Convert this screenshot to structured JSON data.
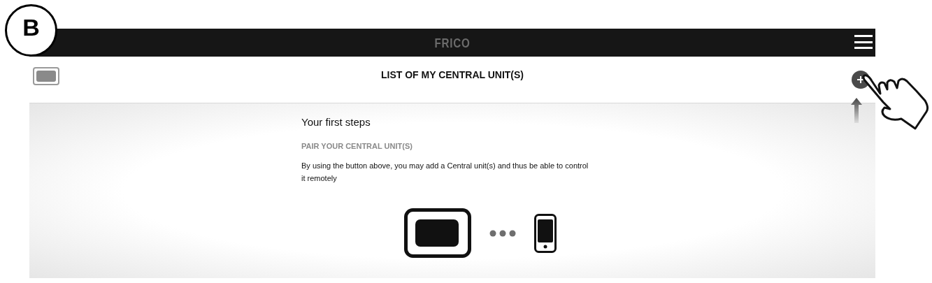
{
  "step_label": "B",
  "top_bar": {
    "logo": "FRICO"
  },
  "header": {
    "title": "LIST OF MY CENTRAL UNIT(S)"
  },
  "intro": {
    "heading": "Your first steps",
    "subheading": "PAIR YOUR CENTRAL UNIT(S)",
    "body": "By using the button above, you may add a Central unit(s) and thus be able to control it remotely"
  }
}
